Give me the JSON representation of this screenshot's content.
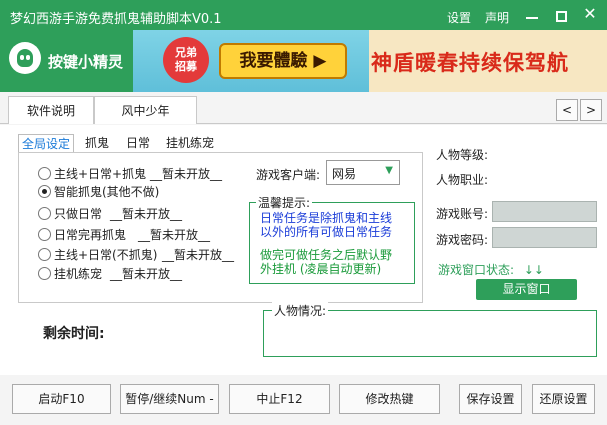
{
  "window": {
    "title": "梦幻西游手游免费抓鬼辅助脚本V0.1",
    "settings_label": "设置",
    "statement_label": "声明",
    "minimize_glyph": "",
    "maximize_glyph": "",
    "close_glyph": "✕"
  },
  "header": {
    "logo_text": "按键小精灵",
    "banner_badge_line1": "兄弟",
    "banner_badge_line2": "招募",
    "banner_cta": "我要體驗 ▶",
    "banner_slogan": "神盾暖春持续保驾航"
  },
  "main_tabs": [
    {
      "label": "软件说明"
    },
    {
      "label": "风中少年"
    }
  ],
  "nav": {
    "prev": "<",
    "next": ">"
  },
  "inner_tabs": [
    {
      "label": "全局设定"
    },
    {
      "label": "抓鬼"
    },
    {
      "label": "日常"
    },
    {
      "label": "挂机练宠"
    }
  ],
  "modes": [
    {
      "label": "主线+日常+抓鬼",
      "note": "__暂未开放__",
      "checked": false
    },
    {
      "label": "智能抓鬼(其他不做)",
      "note": "",
      "checked": true
    },
    {
      "label": "只做日常",
      "note": "__暂未开放__",
      "checked": false
    },
    {
      "label": "日常完再抓鬼",
      "note": "__暂未开放__",
      "checked": false
    },
    {
      "label": "主线+日常(不抓鬼)",
      "note": "__暂未开放__",
      "checked": false
    },
    {
      "label": "挂机练宠",
      "note": "__暂未开放__",
      "checked": false
    }
  ],
  "client": {
    "label": "游戏客户端:",
    "value": "网易"
  },
  "tips": {
    "title": "温馨提示:",
    "blue_line1": "日常任务是除抓鬼和主线",
    "blue_line2": "以外的所有可做日常任务",
    "green_line1": "做完可做任务之后默认野",
    "green_line2": "外挂机  (凌晨自动更新)"
  },
  "character": {
    "level_label": "人物等级:",
    "job_label": "人物职业:",
    "account_label": "游戏账号:",
    "password_label": "游戏密码:",
    "account_value": "",
    "password_value": "",
    "window_status_label": "游戏窗口状态:",
    "window_status_arrows": "↓↓",
    "show_window_button": "显示窗口"
  },
  "remaining": {
    "label": "剩余时间:"
  },
  "role_box": {
    "title": "人物情况:"
  },
  "bottom_buttons": [
    {
      "label": "启动F10"
    },
    {
      "label": "暂停/继续Num -"
    },
    {
      "label": "中止F12"
    },
    {
      "label": "修改热键"
    },
    {
      "label": "保存设置"
    },
    {
      "label": "还原设置"
    }
  ],
  "colors": {
    "brand_green": "#2e9f5a",
    "tip_blue": "#1a3cd8",
    "tip_green": "#1a9a3a",
    "active_tab": "#1a7ad8"
  }
}
